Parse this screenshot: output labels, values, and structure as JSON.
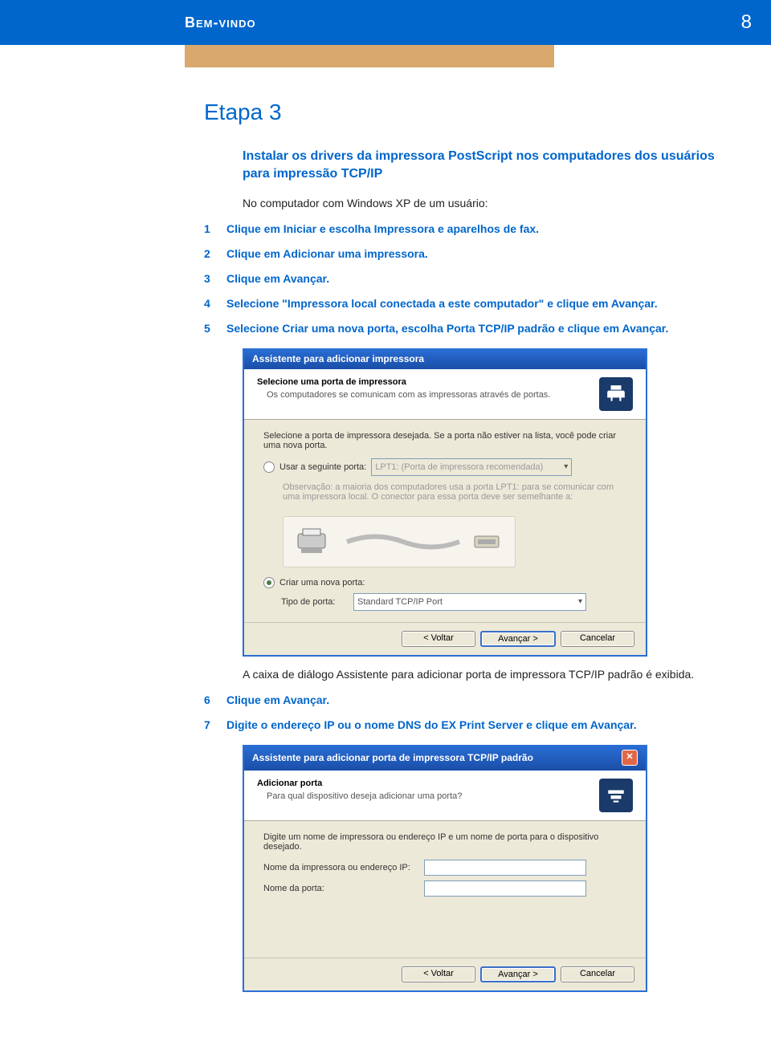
{
  "header": {
    "title": "Bem-vindo",
    "page_number": "8"
  },
  "stage": {
    "label": "Etapa 3"
  },
  "section": {
    "install_title": "Instalar os drivers da impressora PostScript nos computadores dos usuários para impressão TCP/IP",
    "intro": "No computador com Windows XP de um usuário:"
  },
  "steps": [
    {
      "n": "1",
      "t": "Clique em Iniciar e escolha Impressora e aparelhos de fax."
    },
    {
      "n": "2",
      "t": "Clique em Adicionar uma impressora."
    },
    {
      "n": "3",
      "t": "Clique em Avançar."
    },
    {
      "n": "4",
      "t": "Selecione \"Impressora local conectada a este computador\" e clique em Avançar."
    },
    {
      "n": "5",
      "t": "Selecione Criar uma nova porta, escolha Porta TCP/IP padrão e clique em Avançar."
    }
  ],
  "post_dialog_text": "A caixa de diálogo Assistente para adicionar porta de impressora TCP/IP padrão é exibida.",
  "steps2": [
    {
      "n": "6",
      "t": "Clique em Avançar."
    },
    {
      "n": "7",
      "t": "Digite o endereço IP ou o nome DNS do EX Print Server e clique em Avançar."
    }
  ],
  "dialog1": {
    "title": "Assistente para adicionar impressora",
    "head_title": "Selecione uma porta de impressora",
    "head_sub": "Os computadores se comunicam com as impressoras através de portas.",
    "body_intro": "Selecione a porta de impressora desejada. Se a porta não estiver na lista, você pode criar uma nova porta.",
    "opt_use_port": "Usar a seguinte porta:",
    "port_combo": "LPT1: (Porta de impressora recomendada)",
    "note": "Observação: a maioria dos computadores usa a porta LPT1: para se comunicar com uma impressora local. O conector para essa porta deve ser semelhante a:",
    "opt_create_port": "Criar uma nova porta:",
    "port_type_label": "Tipo de porta:",
    "port_type_value": "Standard TCP/IP Port",
    "btn_back": "< Voltar",
    "btn_next": "Avançar >",
    "btn_cancel": "Cancelar"
  },
  "dialog2": {
    "title": "Assistente para adicionar porta de impressora TCP/IP padrão",
    "head_title": "Adicionar porta",
    "head_sub": "Para qual dispositivo deseja adicionar uma porta?",
    "body_intro": "Digite um nome de impressora ou endereço IP e um nome de porta para o dispositivo desejado.",
    "field_ip": "Nome da impressora ou endereço IP:",
    "field_port": "Nome da porta:",
    "btn_back": "< Voltar",
    "btn_next": "Avançar >",
    "btn_cancel": "Cancelar"
  }
}
